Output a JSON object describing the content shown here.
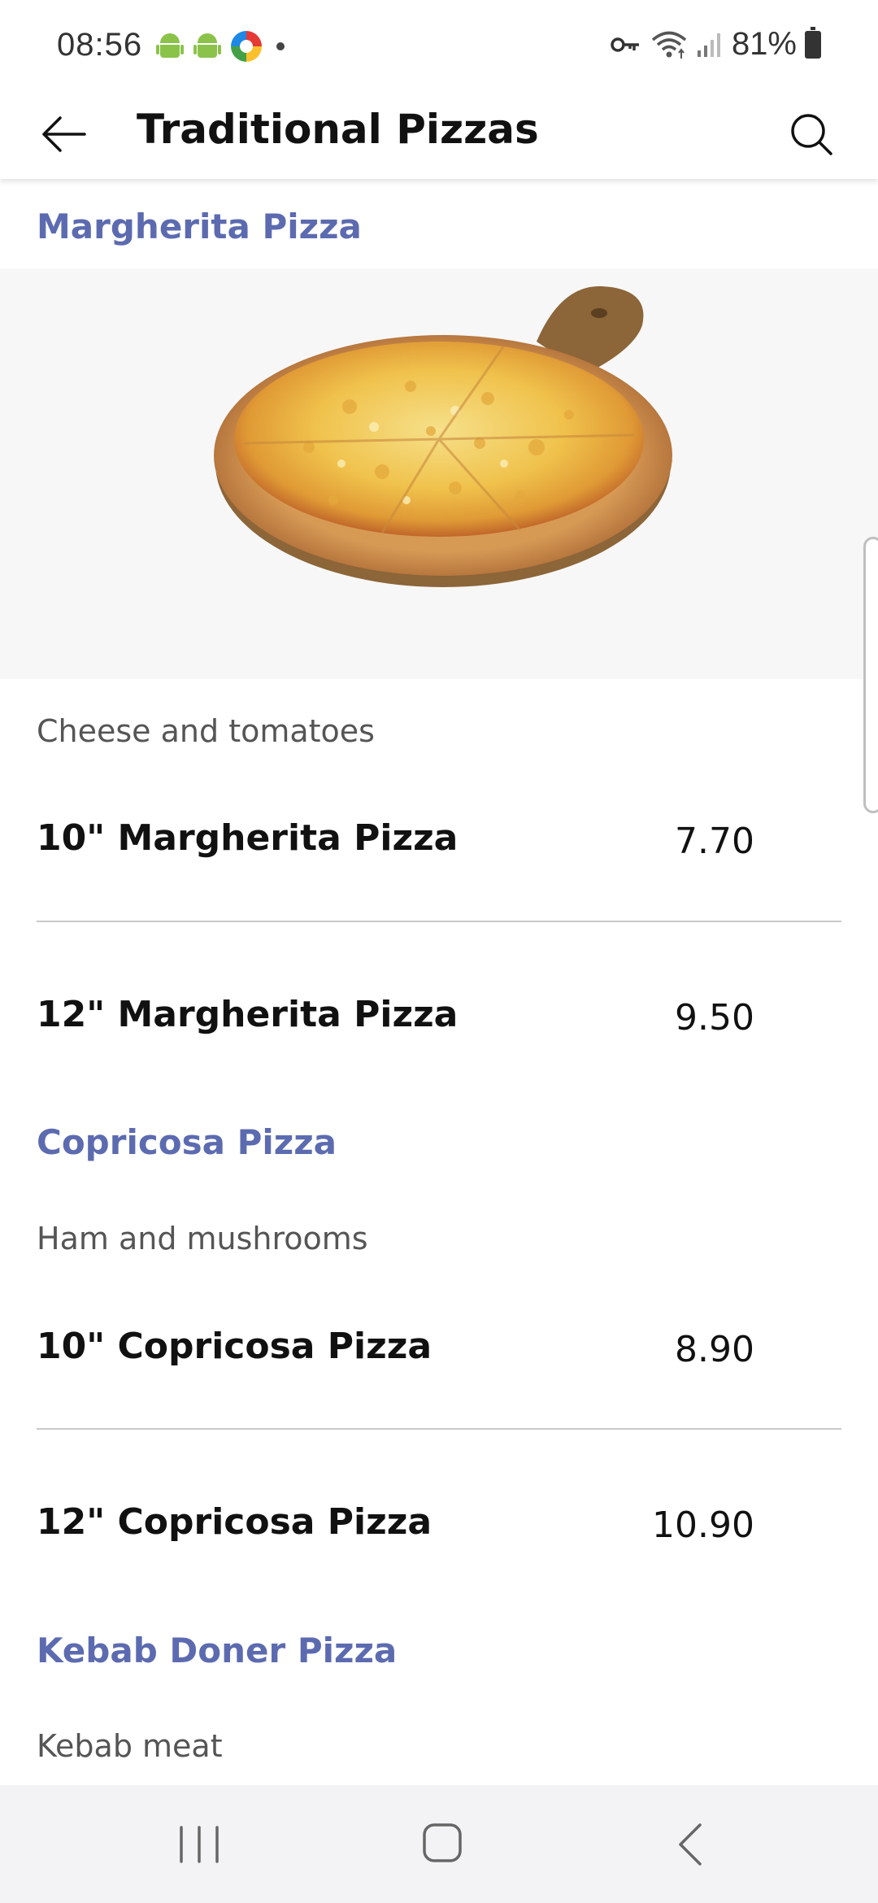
{
  "status_bar": {
    "time": "08:56",
    "battery": "81%",
    "icons": [
      "android-icon",
      "android-icon",
      "color-circle-icon",
      "dot-icon",
      "key-icon",
      "wifi-icon",
      "signal-icon",
      "battery-icon"
    ]
  },
  "app_bar": {
    "title": "Traditional Pizzas",
    "back_icon": "arrow-left-icon",
    "search_icon": "search-icon"
  },
  "sections": [
    {
      "title": "Margherita Pizza",
      "description": "Cheese and tomatoes",
      "items": [
        {
          "name": "10\" Margherita Pizza",
          "price": "7.70"
        },
        {
          "name": "12\" Margherita Pizza",
          "price": "9.50"
        }
      ]
    },
    {
      "title": "Copricosa Pizza",
      "description": "Ham and mushrooms",
      "items": [
        {
          "name": "10\" Copricosa Pizza",
          "price": "8.90"
        },
        {
          "name": "12\" Copricosa Pizza",
          "price": "10.90"
        }
      ]
    },
    {
      "title": "Kebab Doner Pizza",
      "description": "Kebab meat"
    }
  ],
  "nav_bar": {
    "icons": [
      "recent-apps-icon",
      "home-icon",
      "back-icon"
    ]
  },
  "colors": {
    "section_title": "#5c6bb0",
    "divider": "#c9c9c9",
    "nav_bar_bg": "#f3f3f5"
  }
}
